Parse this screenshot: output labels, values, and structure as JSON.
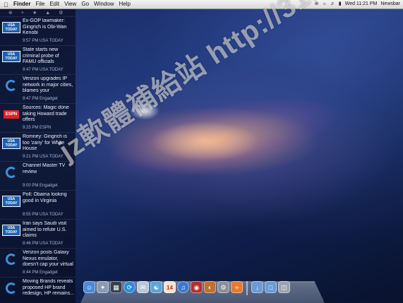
{
  "menubar": {
    "app_name": "Finder",
    "menus": [
      "File",
      "Edit",
      "View",
      "Go",
      "Window",
      "Help"
    ],
    "clock": "Wed 11:21 PM",
    "right_app": "Newsbar"
  },
  "newsbar": {
    "items": [
      {
        "title": "Ex-GOP lawmaker: Gingrich is Obi-Wan Kenobi",
        "meta": "9:57 PM USA TODAY",
        "source": "usa"
      },
      {
        "title": "State starts new criminal probe of FAMU officials",
        "meta": "9:47 PM USA TODAY",
        "source": "usa"
      },
      {
        "title": "Verizon upgrades IP network in major cities, blames your bandwidt...",
        "meta": "9:47 PM Engadget",
        "source": "engadget"
      },
      {
        "title": "Sources: Magic done taking Howard trade offers",
        "meta": "9:25 PM ESPN",
        "source": "espn"
      },
      {
        "title": "Romney: Gingrich is too 'zany' for White House",
        "meta": "9:21 PM USA TODAY",
        "source": "usa"
      },
      {
        "title": "Channel Master TV review",
        "meta": "9:00 PM Engadget",
        "source": "engadget"
      },
      {
        "title": "Poll: Obama looking good in Virginia",
        "meta": "8:55 PM USA TODAY",
        "source": "usa"
      },
      {
        "title": "Iran says Saudi visit aimed to refute U.S. claims",
        "meta": "8:46 PM USA TODAY",
        "source": "usa"
      },
      {
        "title": "Verizon posts Galaxy Nexus emulator, doesn't cap your virtual data",
        "meta": "8:44 PM Engadget",
        "source": "engadget"
      },
      {
        "title": "Moving Brands reveals proposed HP brand redesign, HP remains...",
        "meta": "",
        "source": "engadget"
      }
    ]
  },
  "logos": {
    "usa_line1": "USA",
    "usa_line2": "TODAY",
    "espn": "ESPN"
  },
  "watermark": "jz軟體補給站 http://31.to",
  "dock": {
    "icons": [
      "finder-icon",
      "launchpad-icon",
      "mission-control-icon",
      "safari-icon",
      "mail-icon",
      "contacts-icon",
      "calendar-icon",
      "itunes-icon",
      "photobooth-icon",
      "preview-icon",
      "system-preferences-icon",
      "rss-icon",
      "downloads-icon",
      "documents-icon",
      "trash-icon"
    ],
    "calendar_day": "14"
  },
  "colors": {
    "newsbar_bg": "#080e20",
    "usa_today_blue": "#1f5fb0",
    "engadget_blue": "#3a8fe0",
    "espn_red": "#dd2222"
  }
}
